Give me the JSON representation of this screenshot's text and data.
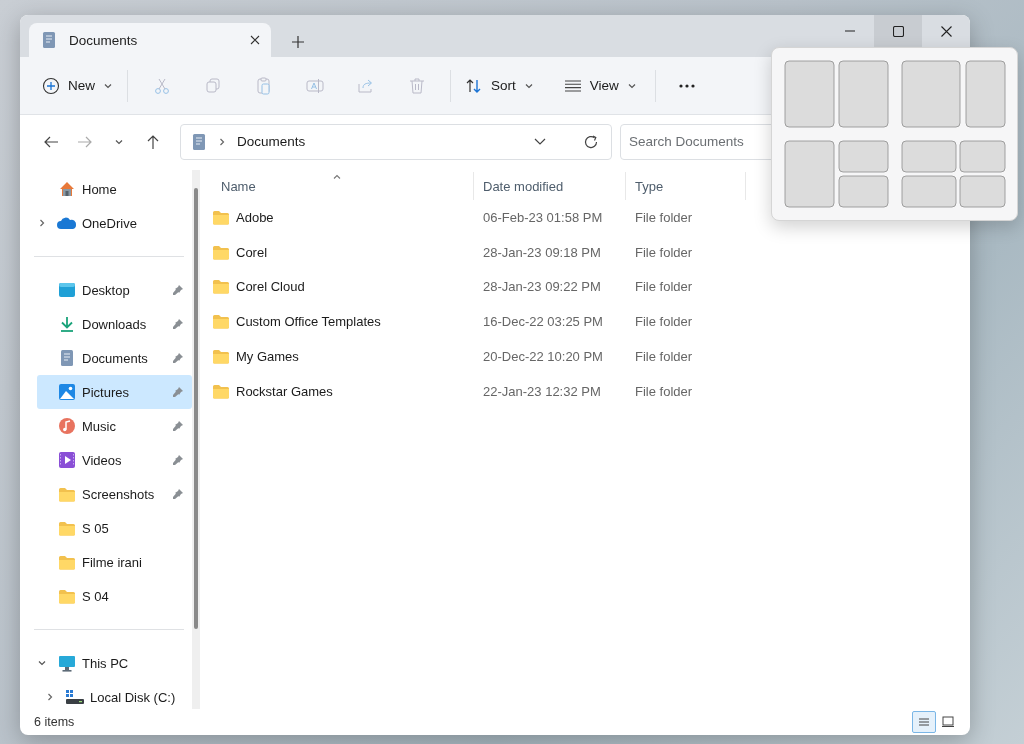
{
  "tabs": [
    {
      "label": "Documents",
      "selected": true
    }
  ],
  "window_controls": [
    {
      "kind": "minimize",
      "hovered": false
    },
    {
      "kind": "maximize",
      "hovered": true
    },
    {
      "kind": "close",
      "hovered": false
    }
  ],
  "toolbar": {
    "new_label": "New",
    "actions": [
      {
        "kind": "cut",
        "disabled": true
      },
      {
        "kind": "copy",
        "disabled": true
      },
      {
        "kind": "paste",
        "disabled": true
      },
      {
        "kind": "rename",
        "disabled": true
      },
      {
        "kind": "share",
        "disabled": true
      },
      {
        "kind": "delete",
        "disabled": true
      }
    ],
    "sort_label": "Sort",
    "view_label": "View"
  },
  "address": {
    "crumbs": [
      "Documents"
    ]
  },
  "search": {
    "placeholder": "Search Documents"
  },
  "sidebar": {
    "sections": [
      [
        {
          "label": "Home",
          "kind": "home",
          "selected": false,
          "pinned": false
        },
        {
          "label": "OneDrive",
          "kind": "cloud",
          "selected": false,
          "pinned": false,
          "expanded": false
        }
      ],
      [
        {
          "label": "Desktop",
          "kind": "desktop",
          "selected": false,
          "pinned": true
        },
        {
          "label": "Downloads",
          "kind": "downloads",
          "selected": false,
          "pinned": true
        },
        {
          "label": "Documents",
          "kind": "documents",
          "selected": false,
          "pinned": true
        },
        {
          "label": "Pictures",
          "kind": "pictures",
          "selected": true,
          "pinned": true
        },
        {
          "label": "Music",
          "kind": "music",
          "selected": false,
          "pinned": true
        },
        {
          "label": "Videos",
          "kind": "videos",
          "selected": false,
          "pinned": true
        },
        {
          "label": "Screenshots",
          "kind": "folder",
          "selected": false,
          "pinned": true
        },
        {
          "label": "S 05",
          "kind": "folder",
          "selected": false,
          "pinned": false
        },
        {
          "label": "Filme irani",
          "kind": "folder",
          "selected": false,
          "pinned": false
        },
        {
          "label": "S 04",
          "kind": "folder",
          "selected": false,
          "pinned": false
        }
      ],
      [
        {
          "label": "This PC",
          "kind": "pc",
          "selected": false,
          "pinned": false,
          "expanded": true,
          "children": [
            {
              "label": "Local Disk (C:)",
              "kind": "drive",
              "selected": false,
              "pinned": false,
              "expanded": false
            }
          ]
        }
      ]
    ]
  },
  "table": {
    "columns": [
      {
        "label": "Name",
        "sorted": true
      },
      {
        "label": "Date modified",
        "sorted": false
      },
      {
        "label": "Type",
        "sorted": false
      }
    ],
    "rows": [
      {
        "name": "Adobe",
        "date": "06-Feb-23 01:58 PM",
        "type": "File folder"
      },
      {
        "name": "Corel",
        "date": "28-Jan-23 09:18 PM",
        "type": "File folder"
      },
      {
        "name": "Corel Cloud",
        "date": "28-Jan-23 09:22 PM",
        "type": "File folder"
      },
      {
        "name": "Custom Office Templates",
        "date": "16-Dec-22 03:25 PM",
        "type": "File folder"
      },
      {
        "name": "My Games",
        "date": "20-Dec-22 10:20 PM",
        "type": "File folder"
      },
      {
        "name": "Rockstar Games",
        "date": "22-Jan-23 12:32 PM",
        "type": "File folder"
      }
    ]
  },
  "status_bar": {
    "count": "6 items",
    "view_buttons": [
      {
        "kind": "details",
        "selected": true
      },
      {
        "kind": "tiles",
        "selected": false
      }
    ]
  }
}
